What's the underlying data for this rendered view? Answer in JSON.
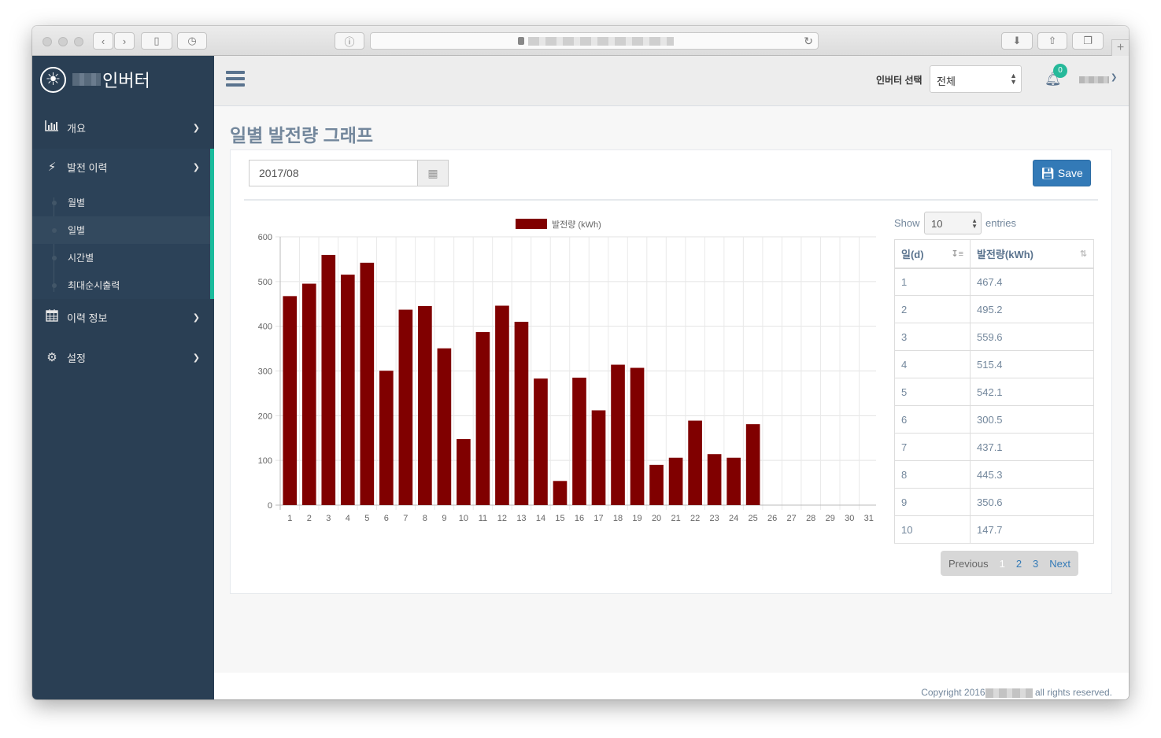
{
  "brand": {
    "name_suffix": "인버터"
  },
  "sidebar": {
    "overview": {
      "label": "개요"
    },
    "gen_history": {
      "label": "발전 이력"
    },
    "sub_items": [
      {
        "label": "월별"
      },
      {
        "label": "일별"
      },
      {
        "label": "시간별"
      },
      {
        "label": "최대순시출력"
      }
    ],
    "history_info": {
      "label": "이력 정보"
    },
    "settings": {
      "label": "설정"
    }
  },
  "topnav": {
    "inverter_label": "인버터 선택",
    "inverter_value": "전체",
    "notification_count": "0"
  },
  "page": {
    "title": "일별 발전량 그래프"
  },
  "filter": {
    "date_value": "2017/08",
    "save_label": "Save"
  },
  "datatable": {
    "show_label": "Show",
    "length_value": "10",
    "entries_label": "entries",
    "columns": [
      "일(d)",
      "발전량(kWh)"
    ],
    "rows": [
      [
        "1",
        "467.4"
      ],
      [
        "2",
        "495.2"
      ],
      [
        "3",
        "559.6"
      ],
      [
        "4",
        "515.4"
      ],
      [
        "5",
        "542.1"
      ],
      [
        "6",
        "300.5"
      ],
      [
        "7",
        "437.1"
      ],
      [
        "8",
        "445.3"
      ],
      [
        "9",
        "350.6"
      ],
      [
        "10",
        "147.7"
      ]
    ],
    "pagination": {
      "previous": "Previous",
      "pages": [
        "1",
        "2",
        "3"
      ],
      "next": "Next"
    }
  },
  "footer": {
    "copyright_prefix": "Copyright 2016",
    "copyright_suffix": "all rights reserved."
  },
  "colors": {
    "bar": "#800000",
    "sidebar": "#2a3f54",
    "accent": "#1ABB9C",
    "primary": "#337ab7"
  },
  "chart_data": {
    "type": "bar",
    "categories": [
      "1",
      "2",
      "3",
      "4",
      "5",
      "6",
      "7",
      "8",
      "9",
      "10",
      "11",
      "12",
      "13",
      "14",
      "15",
      "16",
      "17",
      "18",
      "19",
      "20",
      "21",
      "22",
      "23",
      "24",
      "25",
      "26",
      "27",
      "28",
      "29",
      "30",
      "31"
    ],
    "series": [
      {
        "name": "발전량 (kWh)",
        "values": [
          467.4,
          495.2,
          559.6,
          515.4,
          542.1,
          300.5,
          437.1,
          445.3,
          350.6,
          147.7,
          387,
          446,
          410,
          283,
          54,
          285,
          212,
          314,
          307,
          90,
          106,
          189,
          114,
          106,
          181,
          0,
          0,
          0,
          0,
          0,
          0
        ]
      }
    ],
    "ylim": [
      0,
      600
    ],
    "yticks": [
      "0",
      "100",
      "200",
      "300",
      "400",
      "500",
      "600"
    ],
    "grid": true,
    "legend": "top-center"
  }
}
